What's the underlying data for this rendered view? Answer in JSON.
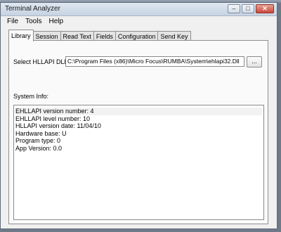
{
  "window": {
    "title": "Terminal Analyzer",
    "buttons": {
      "minimize": "–",
      "maximize": "□",
      "close": "✕"
    }
  },
  "menu": [
    "File",
    "Tools",
    "Help"
  ],
  "tabs": [
    "Library",
    "Session",
    "Read Text",
    "Fields",
    "Configuration",
    "Send Key"
  ],
  "active_tab": "Library",
  "library": {
    "dll_label": "Select HLLAPI DLL",
    "dll_path": "C:\\Program Files (x86)\\Micro Focus\\RUMBA\\System\\ehlapi32.Dll",
    "browse_label": "...",
    "system_info_label": "System Info:",
    "system_info_lines": [
      "EHLLAPI version number: 4",
      "EHLLAPI level number: 10",
      "HLLAPI version date: 11/04/10",
      "Hardware base: U",
      "Program type: 0",
      "App Version: 0.0"
    ]
  },
  "colors": {
    "desktop": "#6e7a88",
    "window_bg": "#f0f0f0",
    "close_button": "#c8473a"
  }
}
